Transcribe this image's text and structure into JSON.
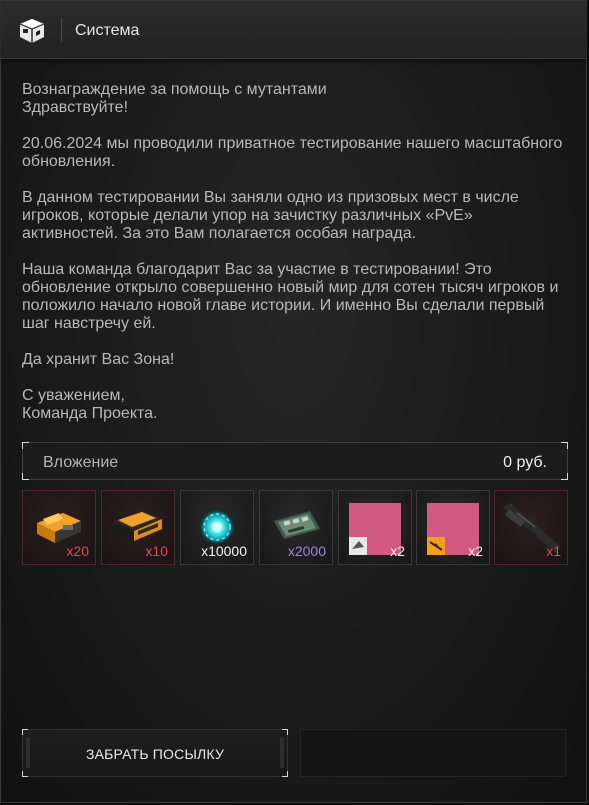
{
  "header": {
    "title": "Система",
    "icon": "package-icon"
  },
  "message": {
    "paragraphs": [
      "Вознаграждение за помощь с мутантами\nЗдравствуйте!",
      "20.06.2024 мы проводили приватное тестирование нашего масштабного обновления.",
      "В данном тестировании Вы заняли одно из призовых мест в числе игроков, которые делали упор на зачистку различных «PvE» активностей. За это Вам полагается особая награда.",
      "Наша команда благодарит Вас за участие в тестировании! Это обновление открыло совершенно новый мир для сотен тысяч игроков и положило начало новой главе истории. И именно Вы сделали первый шаг навстречу ей.",
      "Да хранит Вас Зона!",
      "С уважением,\nКоманда Проекта."
    ]
  },
  "attachment": {
    "label": "Вложение",
    "price": "0 руб."
  },
  "items": [
    {
      "icon": "orange-crate-icon",
      "qty": "x20",
      "qty_color": "#e34a55"
    },
    {
      "icon": "dark-orange-crate-icon",
      "qty": "x10",
      "qty_color": "#e34a55"
    },
    {
      "icon": "cyan-energy-orb-icon",
      "qty": "x10000",
      "qty_color": "#f2f2f2"
    },
    {
      "icon": "green-device-icon",
      "qty": "x2000",
      "qty_color": "#9b86e8"
    },
    {
      "icon": "pink-card-white-badge-icon",
      "qty": "x2",
      "qty_color": "#f2f2f2"
    },
    {
      "icon": "pink-card-orange-badge-icon",
      "qty": "x2",
      "qty_color": "#f2f2f2"
    },
    {
      "icon": "rifle-icon",
      "qty": "x1",
      "qty_color": "#e34a55"
    }
  ],
  "actions": {
    "claim_label": "ЗАБРАТЬ ПОСЫЛКУ"
  },
  "colors": {
    "accent_red": "#e34a55",
    "accent_purple": "#9b86e8",
    "pink_card": "#d25a82",
    "background": "#1a1a1a"
  }
}
